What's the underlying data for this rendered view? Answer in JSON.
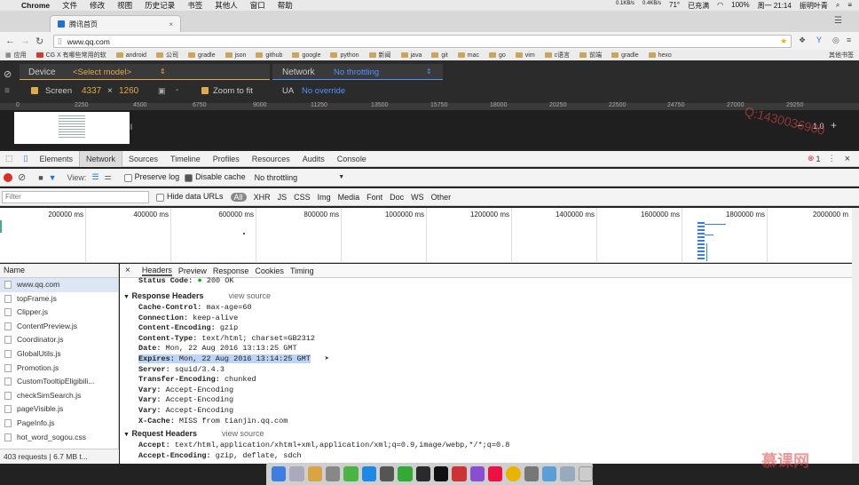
{
  "menubar": {
    "app": "Chrome",
    "items": [
      "文件",
      "修改",
      "视图",
      "历史记录",
      "书签",
      "其他人",
      "窗口",
      "帮助"
    ],
    "right": [
      "71°",
      "已充满",
      "100%",
      "周一 21:14",
      "振明叶青"
    ],
    "net_speed": [
      "0.1KB/s",
      "0.4KB/s"
    ]
  },
  "tab": {
    "title": "腾讯首页"
  },
  "url": "www.qq.com",
  "bookmarks": {
    "apps": "应用",
    "items": [
      "CG X 有哪些常用的软",
      "android",
      "公司",
      "gradle",
      "json",
      "github",
      "google",
      "python",
      "新闻",
      "java",
      "git",
      "mac",
      "go",
      "vim",
      "c语言",
      "前端",
      "gradle",
      "hexo"
    ],
    "more": "其他书签"
  },
  "emulation": {
    "device_label": "Device",
    "device_value": "<Select model>",
    "screen_label": "Screen",
    "screen_w": "4337",
    "screen_x": "×",
    "screen_h": "1260",
    "zoom_label": "Zoom to fit",
    "network_label": "Network",
    "network_value": "No throttling",
    "ua_label": "UA",
    "ua_value": "No override",
    "zoom_value": "1.0"
  },
  "ruler": [
    "0",
    "2250",
    "4500",
    "6750",
    "9000",
    "11250",
    "13500",
    "15750",
    "18000",
    "20250",
    "22500",
    "24750",
    "27000",
    "29250"
  ],
  "devtools": {
    "tabs": [
      "Elements",
      "Network",
      "Sources",
      "Timeline",
      "Profiles",
      "Resources",
      "Audits",
      "Console"
    ],
    "active_tab": "Network",
    "error_count": "1"
  },
  "network_toolbar": {
    "view_label": "View:",
    "preserve_log": "Preserve log",
    "disable_cache": "Disable cache",
    "throttle": "No throttling"
  },
  "filter": {
    "placeholder": "Filter",
    "hide_data_urls": "Hide data URLs",
    "types": [
      "All",
      "XHR",
      "JS",
      "CSS",
      "Img",
      "Media",
      "Font",
      "Doc",
      "WS",
      "Other"
    ]
  },
  "overview_labels": [
    "200000 ms",
    "400000 ms",
    "600000 ms",
    "800000 ms",
    "1000000 ms",
    "1200000 ms",
    "1400000 ms",
    "1600000 ms",
    "1800000 ms",
    "2000000 m"
  ],
  "requests": {
    "header": "Name",
    "items": [
      "www.qq.com",
      "topFrame.js",
      "Clipper.js",
      "ContentPreview.js",
      "Coordinator.js",
      "GlobalUtils.js",
      "Promotion.js",
      "CustomTooltipEligibili...",
      "checkSimSearch.js",
      "pageVisible.js",
      "PageInfo.js",
      "hot_word_sogou.css"
    ],
    "summary": "403 requests | 6.7 MB t..."
  },
  "detail": {
    "close": "×",
    "tabs": [
      "Headers",
      "Preview",
      "Response",
      "Cookies",
      "Timing"
    ],
    "status_code_label": "Status Code:",
    "status_code_value": "200 OK",
    "response_section": "Response Headers",
    "view_source": "view source",
    "response_headers": [
      {
        "k": "Cache-Control:",
        "v": "max-age=60"
      },
      {
        "k": "Connection:",
        "v": "keep-alive"
      },
      {
        "k": "Content-Encoding:",
        "v": "gzip"
      },
      {
        "k": "Content-Type:",
        "v": "text/html; charset=GB2312"
      },
      {
        "k": "Date:",
        "v": "Mon, 22 Aug 2016 13:13:25 GMT"
      },
      {
        "k": "Expires:",
        "v": "Mon, 22 Aug 2016 13:14:25 GMT"
      },
      {
        "k": "Server:",
        "v": "squid/3.4.3"
      },
      {
        "k": "Transfer-Encoding:",
        "v": "chunked"
      },
      {
        "k": "Vary:",
        "v": "Accept-Encoding"
      },
      {
        "k": "Vary:",
        "v": "Accept-Encoding"
      },
      {
        "k": "Vary:",
        "v": "Accept-Encoding"
      },
      {
        "k": "X-Cache:",
        "v": "MISS from tianjin.qq.com"
      }
    ],
    "request_section": "Request Headers",
    "request_headers": [
      {
        "k": "Accept:",
        "v": "text/html,application/xhtml+xml,application/xml;q=0.9,image/webp,*/*;q=0.8"
      },
      {
        "k": "Accept-Encoding:",
        "v": "gzip, deflate, sdch"
      }
    ]
  },
  "watermark": {
    "corner": "慕课网",
    "phone": "Q:1430036900"
  }
}
